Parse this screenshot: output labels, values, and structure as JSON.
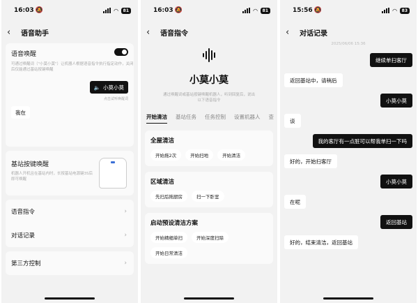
{
  "screen1": {
    "status": {
      "time": "16:03",
      "battery": "81"
    },
    "header": {
      "title": "语音助手"
    },
    "voice_wake": {
      "title": "语音唤醒",
      "desc": "可通过唤醒词（\"小莫小莫\"）让机器人根据语音指令执行指定动作，关闭后仅能通过基站按键唤醒",
      "toggle_on": true,
      "wake_word_button": "小莫小莫",
      "wake_hint": "点击试听唤醒词",
      "reply": "我在"
    },
    "base_wake": {
      "title": "基站按键唤醒",
      "desc": "机器人开机且在基站内时，长按基站电源键3S后即可唤醒"
    },
    "menu": [
      {
        "label": "语音指令"
      },
      {
        "label": "对话记录"
      }
    ],
    "third_party": {
      "label": "第三方控制"
    }
  },
  "screen2": {
    "status": {
      "time": "16:03",
      "battery": "81"
    },
    "header": {
      "title": "语音指令"
    },
    "title": "小莫小莫",
    "desc": "通过唤醒词或基站按键唤醒机器人，听到回复后，说出以下语音指令",
    "tabs": [
      "开始清洁",
      "基站任务",
      "任务控制",
      "设置机器人",
      "查"
    ],
    "groups": [
      {
        "title": "全屋清洁",
        "chips": [
          "开始拖2次",
          "开始扫地",
          "开始清洁"
        ]
      },
      {
        "title": "区域清洁",
        "chips": [
          "先扫后拖厨房",
          "扫一下卧室"
        ]
      },
      {
        "title": "启动预设清洁方案",
        "chips": [
          "开始精细单扫",
          "开始深度扫除",
          "开始日常清洁"
        ]
      }
    ]
  },
  "screen3": {
    "status": {
      "time": "15:56",
      "battery": "83"
    },
    "header": {
      "title": "对话记录"
    },
    "date": "2025/06/06 15:36",
    "messages": [
      {
        "from": "user",
        "text": "继续单扫客厅"
      },
      {
        "from": "robot",
        "text": "返回基站中，请稍后"
      },
      {
        "from": "user",
        "text": "小莫小莫"
      },
      {
        "from": "robot",
        "text": "谈"
      },
      {
        "from": "user",
        "text": "我的客厅有一点脏可以帮我单扫一下吗"
      },
      {
        "from": "robot",
        "text": "好的，开始扫客厅"
      },
      {
        "from": "user",
        "text": "小莫小莫"
      },
      {
        "from": "robot",
        "text": "在呢"
      },
      {
        "from": "user",
        "text": "返回基站"
      },
      {
        "from": "robot",
        "text": "好的，结束清洁，返回基站"
      }
    ]
  }
}
